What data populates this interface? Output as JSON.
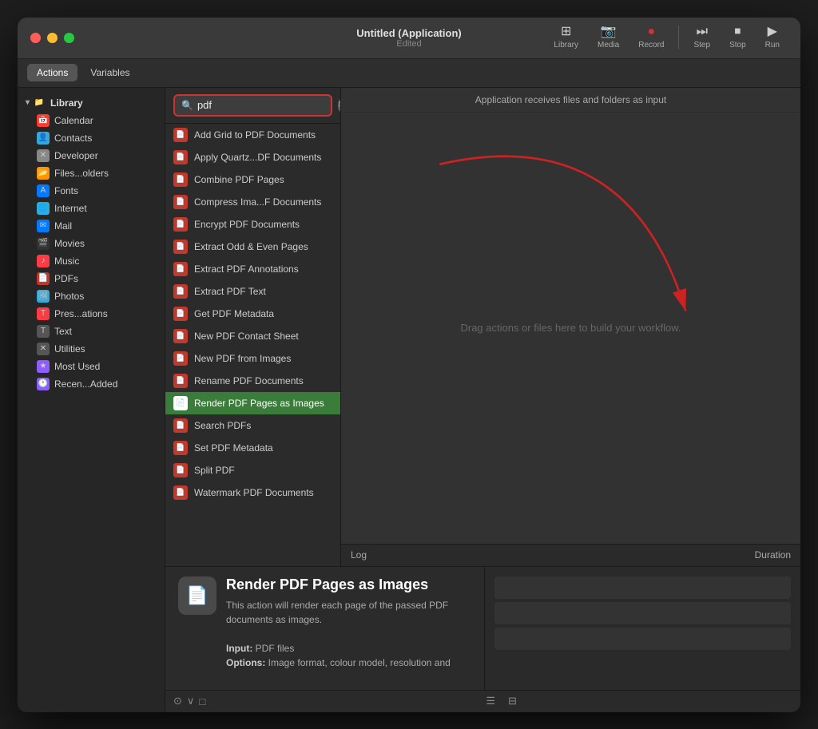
{
  "window": {
    "title": "Untitled (Application)",
    "subtitle": "Edited"
  },
  "toolbar": {
    "library_label": "Library",
    "media_label": "Media",
    "record_label": "Record",
    "step_label": "Step",
    "stop_label": "Stop",
    "run_label": "Run"
  },
  "subtoolbar": {
    "tabs": [
      {
        "id": "actions",
        "label": "Actions",
        "active": true
      },
      {
        "id": "variables",
        "label": "Variables",
        "active": false
      }
    ]
  },
  "sidebar": {
    "group_label": "Library",
    "items": [
      {
        "id": "calendar",
        "label": "Calendar",
        "icon_class": "icon-calendar"
      },
      {
        "id": "contacts",
        "label": "Contacts",
        "icon_class": "icon-contacts"
      },
      {
        "id": "developer",
        "label": "Developer",
        "icon_class": "icon-developer"
      },
      {
        "id": "files",
        "label": "Files...olders",
        "icon_class": "icon-files"
      },
      {
        "id": "fonts",
        "label": "Fonts",
        "icon_class": "icon-fonts"
      },
      {
        "id": "internet",
        "label": "Internet",
        "icon_class": "icon-internet"
      },
      {
        "id": "mail",
        "label": "Mail",
        "icon_class": "icon-mail"
      },
      {
        "id": "movies",
        "label": "Movies",
        "icon_class": "icon-movies"
      },
      {
        "id": "music",
        "label": "Music",
        "icon_class": "icon-music"
      },
      {
        "id": "pdfs",
        "label": "PDFs",
        "icon_class": "icon-pdfs"
      },
      {
        "id": "photos",
        "label": "Photos",
        "icon_class": "icon-photos"
      },
      {
        "id": "presentations",
        "label": "Pres...ations",
        "icon_class": "icon-presentations"
      },
      {
        "id": "text",
        "label": "Text",
        "icon_class": "icon-text"
      },
      {
        "id": "utilities",
        "label": "Utilities",
        "icon_class": "icon-utilities"
      },
      {
        "id": "most-used",
        "label": "Most Used",
        "icon_class": "icon-mostused"
      },
      {
        "id": "recently-added",
        "label": "Recen...Added",
        "icon_class": "icon-recentlyadded"
      }
    ]
  },
  "search": {
    "value": "pdf",
    "placeholder": "Search"
  },
  "action_list": {
    "items": [
      {
        "id": "add-grid",
        "label": "Add Grid to PDF Documents",
        "selected": false
      },
      {
        "id": "apply-quartz",
        "label": "Apply Quartz...DF Documents",
        "selected": false
      },
      {
        "id": "combine",
        "label": "Combine PDF Pages",
        "selected": false
      },
      {
        "id": "compress",
        "label": "Compress Ima...F Documents",
        "selected": false
      },
      {
        "id": "encrypt",
        "label": "Encrypt PDF Documents",
        "selected": false
      },
      {
        "id": "extract-odd",
        "label": "Extract Odd & Even Pages",
        "selected": false
      },
      {
        "id": "extract-annotations",
        "label": "Extract PDF Annotations",
        "selected": false
      },
      {
        "id": "extract-text",
        "label": "Extract PDF Text",
        "selected": false
      },
      {
        "id": "get-metadata",
        "label": "Get PDF Metadata",
        "selected": false
      },
      {
        "id": "new-contact-sheet",
        "label": "New PDF Contact Sheet",
        "selected": false
      },
      {
        "id": "new-from-images",
        "label": "New PDF from Images",
        "selected": false
      },
      {
        "id": "rename",
        "label": "Rename PDF Documents",
        "selected": false
      },
      {
        "id": "render",
        "label": "Render PDF Pages as Images",
        "selected": true
      },
      {
        "id": "search-pdfs",
        "label": "Search PDFs",
        "selected": false
      },
      {
        "id": "set-metadata",
        "label": "Set PDF Metadata",
        "selected": false
      },
      {
        "id": "split",
        "label": "Split PDF",
        "selected": false
      },
      {
        "id": "watermark",
        "label": "Watermark PDF Documents",
        "selected": false
      }
    ]
  },
  "workflow": {
    "header": "Application receives files and folders as input",
    "drop_hint": "Drag actions or files here to build your workflow."
  },
  "log_bar": {
    "log_label": "Log",
    "duration_label": "Duration"
  },
  "bottom_panel": {
    "icon": "📄",
    "title": "Render PDF Pages as Images",
    "description": "This action will render each page of the passed PDF documents as images.",
    "input_label": "Input:",
    "input_value": "PDF files",
    "options_label": "Options:",
    "options_value": "Image format, colour model, resolution and"
  },
  "statusbar": {
    "icons": [
      "⊙",
      "∨",
      "□"
    ]
  }
}
